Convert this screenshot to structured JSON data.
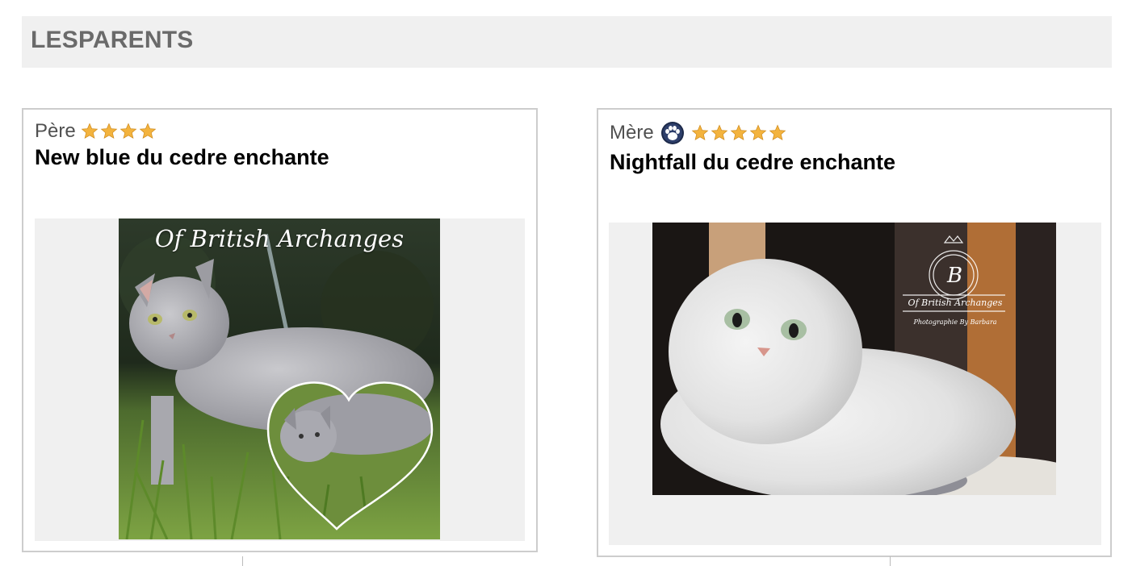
{
  "section": {
    "title": "LESPARENTS"
  },
  "father": {
    "role": "Père",
    "stars": 4,
    "name": "New blue du cedre enchante",
    "photo_watermark": "Of British Archanges"
  },
  "mother": {
    "role": "Mère",
    "stars": 5,
    "name": "Nightfall du cedre enchante",
    "photo_watermark": "Of British Archanges",
    "photo_credit": "Photographie By Barbara"
  },
  "colors": {
    "star": "#f3b33e",
    "header_bg": "#f0f0f0",
    "card_border": "#cdcdcd"
  },
  "icons": {
    "rating": "star-icon",
    "badge": "paw-icon"
  }
}
